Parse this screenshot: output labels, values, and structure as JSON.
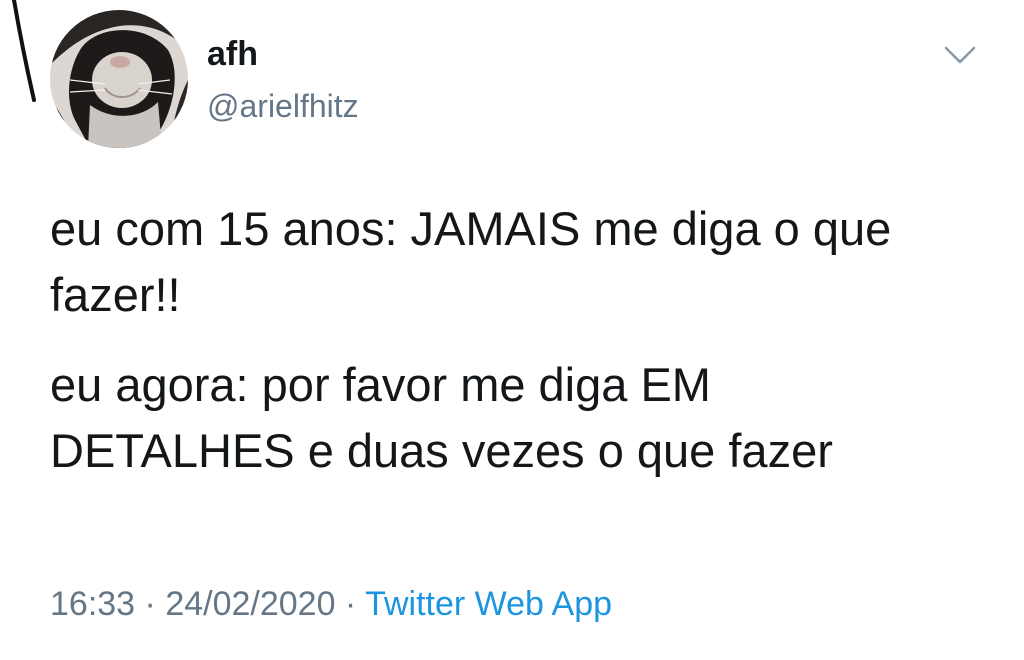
{
  "author": {
    "display_name": "afh",
    "handle": "@arielfhitz"
  },
  "tweet": {
    "lines": [
      "eu com 15 anos: JAMAIS me diga o que fazer!!",
      "eu agora: por favor me diga EM DETALHES e duas vezes o que fazer"
    ]
  },
  "meta": {
    "time": "16:33",
    "separator_1": " · ",
    "date": "24/02/2020",
    "separator_2": " · ",
    "source": "Twitter Web App"
  },
  "colors": {
    "text_primary": "#14171a",
    "text_secondary": "#657786",
    "link": "#1b95e0"
  },
  "icons": {
    "menu": "chevron-down-icon",
    "avatar": "cat-in-hood-avatar"
  }
}
